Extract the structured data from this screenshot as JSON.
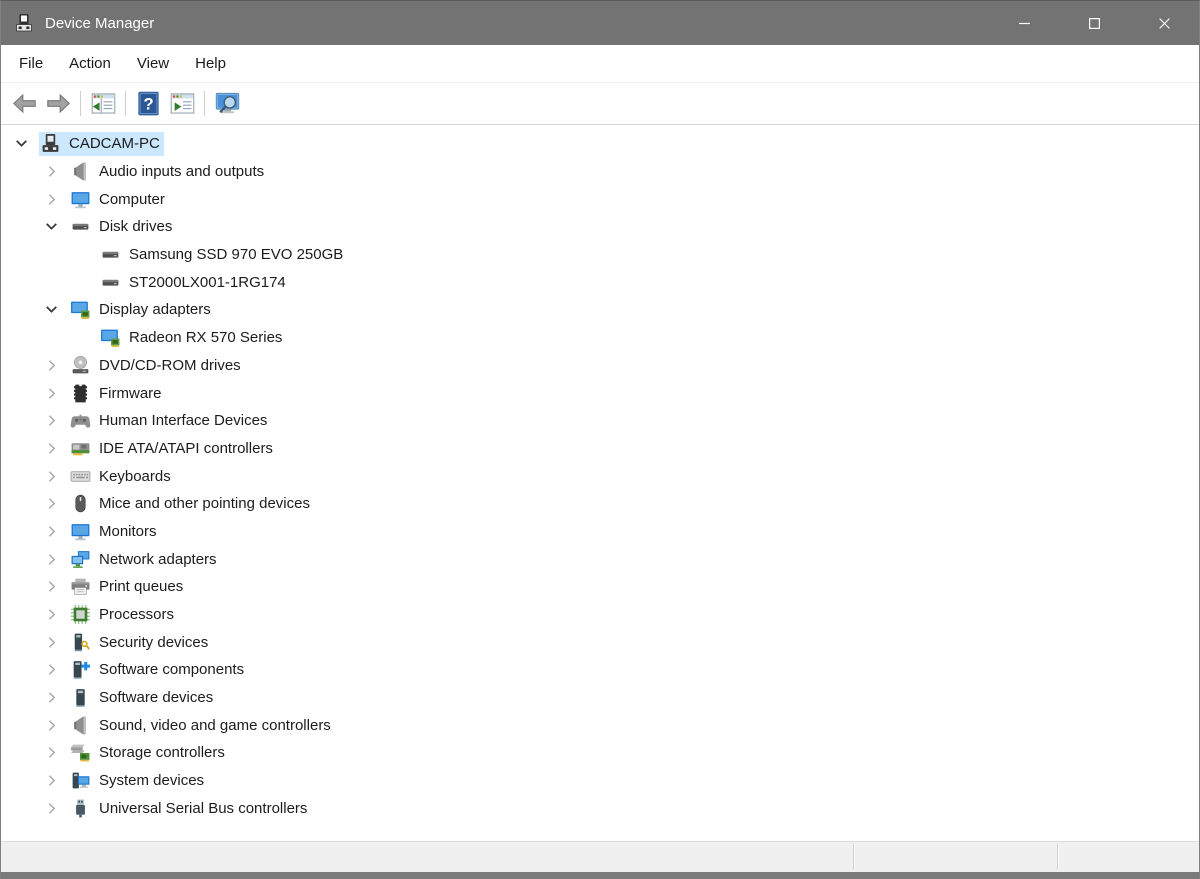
{
  "titlebar": {
    "title": "Device Manager",
    "icon": "device-manager-icon",
    "controls": [
      {
        "name": "minimize-button",
        "icon": "minimize-icon"
      },
      {
        "name": "maximize-button",
        "icon": "maximize-icon"
      },
      {
        "name": "close-button",
        "icon": "close-icon"
      }
    ]
  },
  "menu": {
    "items": [
      "File",
      "Action",
      "View",
      "Help"
    ]
  },
  "toolbar": {
    "buttons": [
      {
        "name": "back-button",
        "icon": "arrow-left-icon"
      },
      {
        "name": "forward-button",
        "icon": "arrow-right-icon"
      },
      {
        "separator": true
      },
      {
        "name": "show-console-tree-button",
        "icon": "console-tree-icon"
      },
      {
        "separator": true
      },
      {
        "name": "help-button",
        "icon": "help-icon"
      },
      {
        "name": "properties-button",
        "icon": "properties-panel-icon"
      },
      {
        "separator": true
      },
      {
        "name": "scan-hardware-changes-button",
        "icon": "scan-hardware-icon"
      }
    ]
  },
  "tree": {
    "items": [
      {
        "label": "CADCAM-PC",
        "level": 0,
        "state": "expanded",
        "icon": "computer-root-icon",
        "selected": true
      },
      {
        "label": "Audio inputs and outputs",
        "level": 1,
        "state": "collapsed",
        "icon": "speaker-icon"
      },
      {
        "label": "Computer",
        "level": 1,
        "state": "collapsed",
        "icon": "monitor-icon"
      },
      {
        "label": "Disk drives",
        "level": 1,
        "state": "expanded",
        "icon": "disk-drive-icon"
      },
      {
        "label": "Samsung SSD 970 EVO 250GB",
        "level": 2,
        "state": "leaf",
        "icon": "disk-drive-icon"
      },
      {
        "label": "ST2000LX001-1RG174",
        "level": 2,
        "state": "leaf",
        "icon": "disk-drive-icon"
      },
      {
        "label": "Display adapters",
        "level": 1,
        "state": "expanded",
        "icon": "display-adapter-icon"
      },
      {
        "label": "Radeon RX 570 Series",
        "level": 2,
        "state": "leaf",
        "icon": "display-adapter-icon"
      },
      {
        "label": "DVD/CD-ROM drives",
        "level": 1,
        "state": "collapsed",
        "icon": "dvd-drive-icon"
      },
      {
        "label": "Firmware",
        "level": 1,
        "state": "collapsed",
        "icon": "firmware-chip-icon"
      },
      {
        "label": "Human Interface Devices",
        "level": 1,
        "state": "collapsed",
        "icon": "gamepad-icon"
      },
      {
        "label": "IDE ATA/ATAPI controllers",
        "level": 1,
        "state": "collapsed",
        "icon": "controller-card-icon"
      },
      {
        "label": "Keyboards",
        "level": 1,
        "state": "collapsed",
        "icon": "keyboard-icon"
      },
      {
        "label": "Mice and other pointing devices",
        "level": 1,
        "state": "collapsed",
        "icon": "mouse-icon"
      },
      {
        "label": "Monitors",
        "level": 1,
        "state": "collapsed",
        "icon": "monitor-icon"
      },
      {
        "label": "Network adapters",
        "level": 1,
        "state": "collapsed",
        "icon": "network-adapter-icon"
      },
      {
        "label": "Print queues",
        "level": 1,
        "state": "collapsed",
        "icon": "printer-icon"
      },
      {
        "label": "Processors",
        "level": 1,
        "state": "collapsed",
        "icon": "processor-icon"
      },
      {
        "label": "Security devices",
        "level": 1,
        "state": "collapsed",
        "icon": "security-device-icon"
      },
      {
        "label": "Software components",
        "level": 1,
        "state": "collapsed",
        "icon": "software-component-icon"
      },
      {
        "label": "Software devices",
        "level": 1,
        "state": "collapsed",
        "icon": "software-device-icon"
      },
      {
        "label": "Sound, video and game controllers",
        "level": 1,
        "state": "collapsed",
        "icon": "speaker-icon"
      },
      {
        "label": "Storage controllers",
        "level": 1,
        "state": "collapsed",
        "icon": "storage-controller-icon"
      },
      {
        "label": "System devices",
        "level": 1,
        "state": "collapsed",
        "icon": "system-device-icon"
      },
      {
        "label": "Universal Serial Bus controllers",
        "level": 1,
        "state": "collapsed",
        "icon": "usb-plug-icon"
      }
    ]
  },
  "statusbar": {
    "sections": [
      "",
      "",
      ""
    ]
  },
  "colors": {
    "titlebar_bg": "#737373",
    "selection_bg": "#cce8ff",
    "statusbar_bg": "#f0f0f0",
    "help_icon_blue": "#2b5797",
    "tree_text": "#1c1c1c"
  }
}
